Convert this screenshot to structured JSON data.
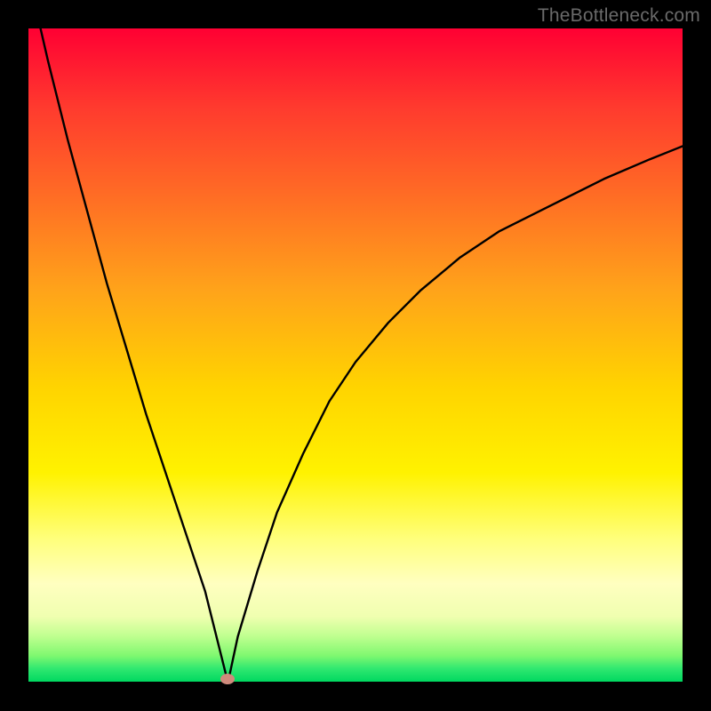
{
  "watermark": "TheBottleneck.com",
  "chart_data": {
    "type": "line",
    "title": "",
    "xlabel": "",
    "ylabel": "",
    "xlim": [
      0,
      100
    ],
    "ylim": [
      0,
      100
    ],
    "background_gradient": {
      "top": "#ff0033",
      "bottom": "#00d860",
      "meaning": "red high / green low"
    },
    "minimum_marker": {
      "x": 30.5,
      "y": 0,
      "color": "#cf8a7c"
    },
    "series": [
      {
        "name": "curve",
        "x": [
          0,
          3,
          6,
          9,
          12,
          15,
          18,
          21,
          24,
          27,
          29,
          30.5,
          32,
          35,
          38,
          42,
          46,
          50,
          55,
          60,
          66,
          72,
          80,
          88,
          95,
          100
        ],
        "values": [
          108,
          95,
          83,
          72,
          61,
          51,
          41,
          32,
          23,
          14,
          6,
          0,
          7,
          17,
          26,
          35,
          43,
          49,
          55,
          60,
          65,
          69,
          73,
          77,
          80,
          82
        ]
      }
    ]
  }
}
